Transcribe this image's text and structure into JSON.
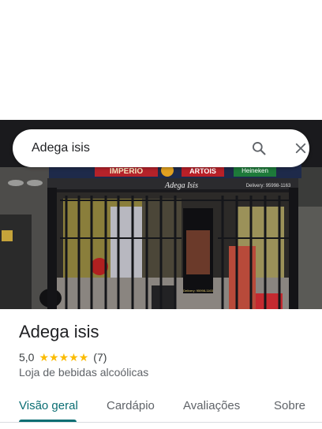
{
  "search": {
    "query": "Adega isis"
  },
  "photo": {
    "signs": {
      "banner_left": "IMPERIO",
      "banner_right": "ARTOIS",
      "brand": "Heineken",
      "store_sign": "Adega Isis",
      "delivery": "Delivery: 95998-1163",
      "menu_phone": "Delivery: 95998-1163"
    }
  },
  "place": {
    "name": "Adega isis",
    "rating": "5,0",
    "stars": 5,
    "reviews": "(7)",
    "category": "Loja de bebidas alcoólicas"
  },
  "tabs": [
    {
      "label": "Visão geral",
      "active": true
    },
    {
      "label": "Cardápio",
      "active": false
    },
    {
      "label": "Avaliações",
      "active": false
    },
    {
      "label": "Sobre",
      "active": false
    }
  ],
  "colors": {
    "accent": "#0b6e73",
    "star": "#fbbc04"
  },
  "icons": {
    "search": "search-icon",
    "close": "close-icon"
  }
}
